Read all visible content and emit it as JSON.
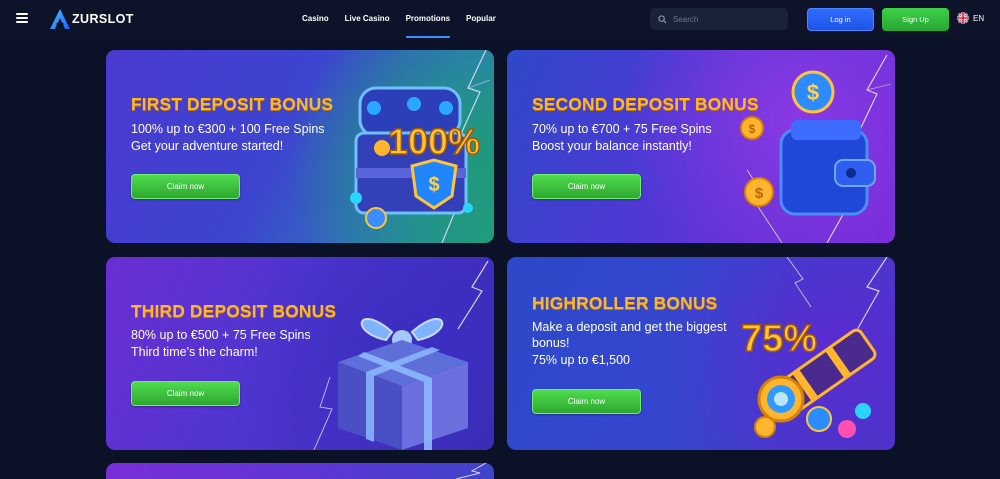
{
  "header": {
    "brand": "ZURSLOT",
    "nav": [
      {
        "label": "Casino"
      },
      {
        "label": "Live Casino"
      },
      {
        "label": "Promotions",
        "active": true
      },
      {
        "label": "Popular"
      }
    ],
    "search_placeholder": "Search",
    "login_label": "Log in",
    "signup_label": "Sign Up",
    "language": "EN"
  },
  "promotions": [
    {
      "title": "FIRST DEPOSIT BONUS",
      "lines": [
        "100% up to €300 + 100 Free Spins",
        "Get your adventure started!"
      ],
      "button": "Claim now",
      "art_text": "100%"
    },
    {
      "title": "SECOND DEPOSIT BONUS",
      "lines": [
        "70% up to €700 + 75 Free Spins",
        "Boost your balance instantly!"
      ],
      "button": "Claim now"
    },
    {
      "title": "THIRD DEPOSIT BONUS",
      "lines": [
        "80% up to €500 + 75 Free Spins",
        "Third time's the charm!"
      ],
      "button": "Claim now"
    },
    {
      "title": "HIGHROLLER BONUS",
      "lines": [
        "Make a deposit and get the biggest",
        "bonus!",
        "75% up to €1,500"
      ],
      "button": "Claim now",
      "art_text": "75%"
    }
  ],
  "colors": {
    "background": "#0b1126",
    "title_gold": "#ffb629",
    "accent_blue": "#2f6dff",
    "accent_green": "#3fd14a"
  }
}
